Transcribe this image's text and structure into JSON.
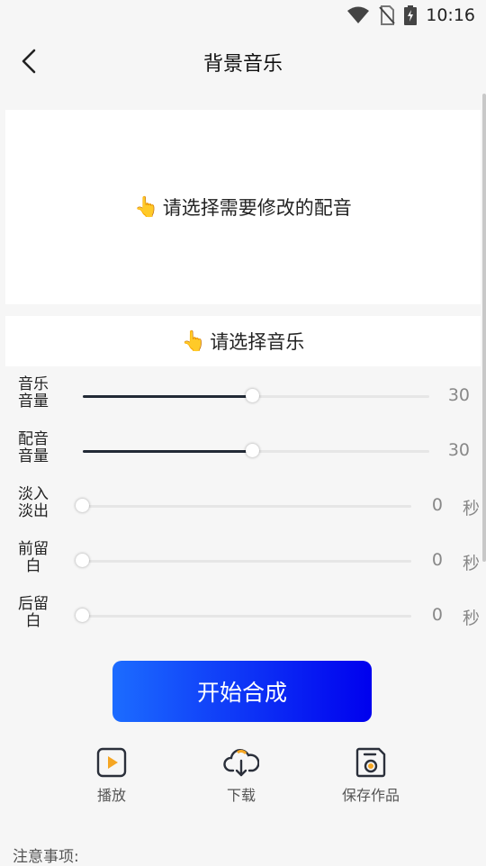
{
  "status_bar": {
    "time": "10:16"
  },
  "header": {
    "title": "背景音乐"
  },
  "select_dub": {
    "hint": "请选择需要修改的配音"
  },
  "select_music": {
    "hint": "请选择音乐"
  },
  "sliders": [
    {
      "label_line1": "音乐",
      "label_line2": "音量",
      "value": "30",
      "unit": "",
      "max": 60
    },
    {
      "label_line1": "配音",
      "label_line2": "音量",
      "value": "30",
      "unit": "",
      "max": 60
    },
    {
      "label_line1": "淡入",
      "label_line2": "淡出",
      "value": "0",
      "unit": "秒",
      "max": 10
    },
    {
      "label_line1": "前留",
      "label_line2": "白",
      "value": "0",
      "unit": "秒",
      "max": 10
    },
    {
      "label_line1": "后留",
      "label_line2": "白",
      "value": "0",
      "unit": "秒",
      "max": 10
    }
  ],
  "start_button": {
    "label": "开始合成"
  },
  "actions": [
    {
      "label": "播放",
      "icon": "play-icon"
    },
    {
      "label": "下载",
      "icon": "cloud-download-icon"
    },
    {
      "label": "保存作品",
      "icon": "save-icon"
    }
  ],
  "notes": {
    "title": "注意事项:"
  },
  "colors": {
    "accent_start": "#1c6cff",
    "accent_end": "#0000ee",
    "action_icon": "#2a2f3a",
    "action_accent": "#f5a623"
  }
}
